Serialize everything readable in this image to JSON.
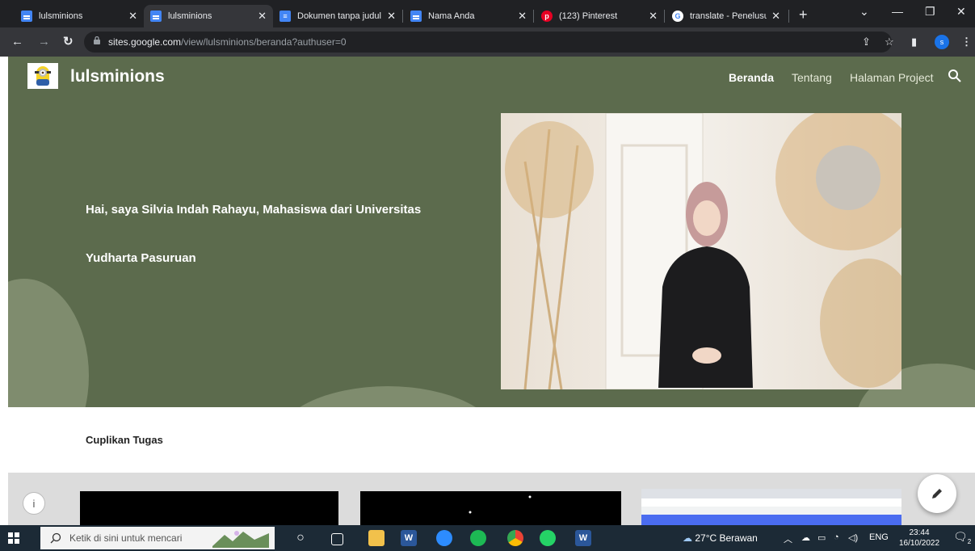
{
  "browser": {
    "tabs": [
      {
        "title": "lulsminions",
        "icon": "google-sites-icon",
        "active": false
      },
      {
        "title": "lulsminions",
        "icon": "google-sites-icon",
        "active": true
      },
      {
        "title": "Dokumen tanpa judul",
        "icon": "google-docs-icon",
        "active": false
      },
      {
        "title": "Nama Anda",
        "icon": "google-sites-icon",
        "active": false
      },
      {
        "title": "(123) Pinterest",
        "icon": "pinterest-icon",
        "active": false
      },
      {
        "title": "translate - Penelusuran",
        "icon": "google-icon",
        "active": false
      }
    ],
    "new_tab": "+",
    "url_domain": "sites.google.com",
    "url_path": "/view/lulsminions/beranda?authuser=0",
    "profile_initial": "s"
  },
  "site": {
    "title": "lulsminions",
    "nav": [
      "Beranda",
      "Tentang",
      "Halaman Project"
    ],
    "hero_line1": "Hai, saya Silvia Indah Rahayu, Mahasiswa dari Universitas",
    "hero_line2": "Yudharta Pasuruan",
    "section_title": "Cuplikan Tugas",
    "info_glyph": "i",
    "hero_bg_color": "#5c6b4d"
  },
  "taskbar": {
    "search_placeholder": "Ketik di sini untuk mencari",
    "weather": "27°C  Berawan",
    "lang": "ENG",
    "time": "23:44",
    "date": "16/10/2022",
    "notif_count": "2"
  }
}
